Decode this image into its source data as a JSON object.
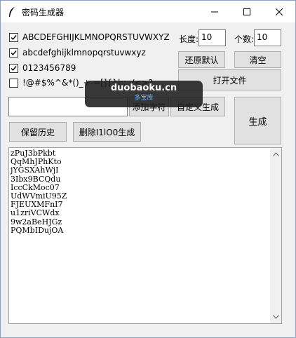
{
  "window": {
    "title": "密码生成器"
  },
  "options": [
    {
      "label": "ABCDEFGHIJKLMNOPQRSTUVWXYZ",
      "checked": true
    },
    {
      "label": "abcdefghijklmnopqrstuvwxyz",
      "checked": true
    },
    {
      "label": "0123456789",
      "checked": true
    },
    {
      "label": "!@#$%^&*()_+-=[]{}|;:,./<>?",
      "checked": false
    }
  ],
  "length": {
    "label": "长度:",
    "value": "10"
  },
  "count": {
    "label": "个数:",
    "value": "10"
  },
  "buttons": {
    "restore_default": "还原默认",
    "clear": "清空",
    "open_file": "打开文件",
    "add_char": "添加字符",
    "custom_generate": "自定义生成",
    "generate": "生成",
    "keep_history": "保留历史",
    "remove_ambiguous": "删除I1lO0生成"
  },
  "custom_input": {
    "value": ""
  },
  "output": [
    "zPuJ3bPkbt",
    "QqMhJPhKto",
    "jYGSXAhWjI",
    "3Ibx9BCQdu",
    "IccCkMoc07",
    "UdWVmiU95Z",
    "FJEUXMFnI7",
    "u1zriVCWdx",
    "9w2aBeHJGz",
    "PQMbIDujOA"
  ],
  "watermark": {
    "site": "duobaoku.cn",
    "sub": "多宝库"
  }
}
